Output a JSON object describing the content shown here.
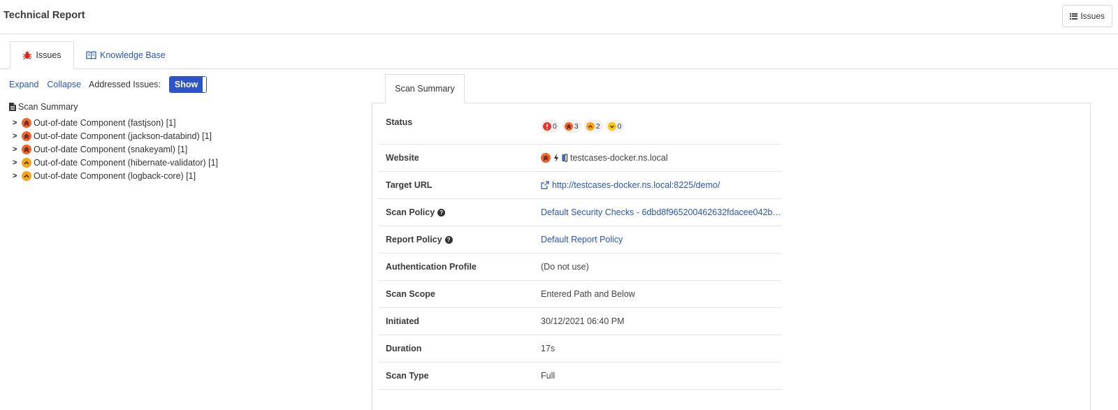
{
  "header": {
    "title": "Technical Report",
    "issues_button": "Issues"
  },
  "tabs": [
    {
      "label": "Issues",
      "icon": "bug-icon",
      "active": true
    },
    {
      "label": "Knowledge Base",
      "icon": "book-icon",
      "active": false
    }
  ],
  "controls": {
    "expand": "Expand",
    "collapse": "Collapse",
    "addressed_label": "Addressed Issues:",
    "toggle_label": "Show"
  },
  "tree": {
    "root": "Scan Summary",
    "items": [
      {
        "label": "Out-of-date Component (fastjson) [1]",
        "severity": "high"
      },
      {
        "label": "Out-of-date Component (jackson-databind) [1]",
        "severity": "high"
      },
      {
        "label": "Out-of-date Component (snakeyaml) [1]",
        "severity": "high"
      },
      {
        "label": "Out-of-date Component (hibernate-validator) [1]",
        "severity": "medium"
      },
      {
        "label": "Out-of-date Component (logback-core) [1]",
        "severity": "medium"
      }
    ]
  },
  "summary": {
    "tab": "Scan Summary",
    "status_label": "Status",
    "status_counts": {
      "critical": "0",
      "high": "3",
      "medium": "2",
      "low": "0"
    },
    "website_label": "Website",
    "website": "testcases-docker.ns.local",
    "target_url_label": "Target URL",
    "target_url": "http://testcases-docker.ns.local:8225/demo/",
    "scan_policy_label": "Scan Policy",
    "scan_policy": "Default Security Checks - 6dbd8f965200462632fdacee042b…",
    "report_policy_label": "Report Policy",
    "report_policy": "Default Report Policy",
    "auth_label": "Authentication Profile",
    "auth": "(Do not use)",
    "scope_label": "Scan Scope",
    "scope": "Entered Path and Below",
    "initiated_label": "Initiated",
    "initiated": "30/12/2021 06:40 PM",
    "duration_label": "Duration",
    "duration": "17s",
    "type_label": "Scan Type",
    "type": "Full"
  },
  "colors": {
    "accent": "#2d52c9",
    "link": "#2a56b0",
    "critical": "#e8362a",
    "high": "#f0632a",
    "medium": "#f8a418",
    "low": "#f7c808"
  }
}
